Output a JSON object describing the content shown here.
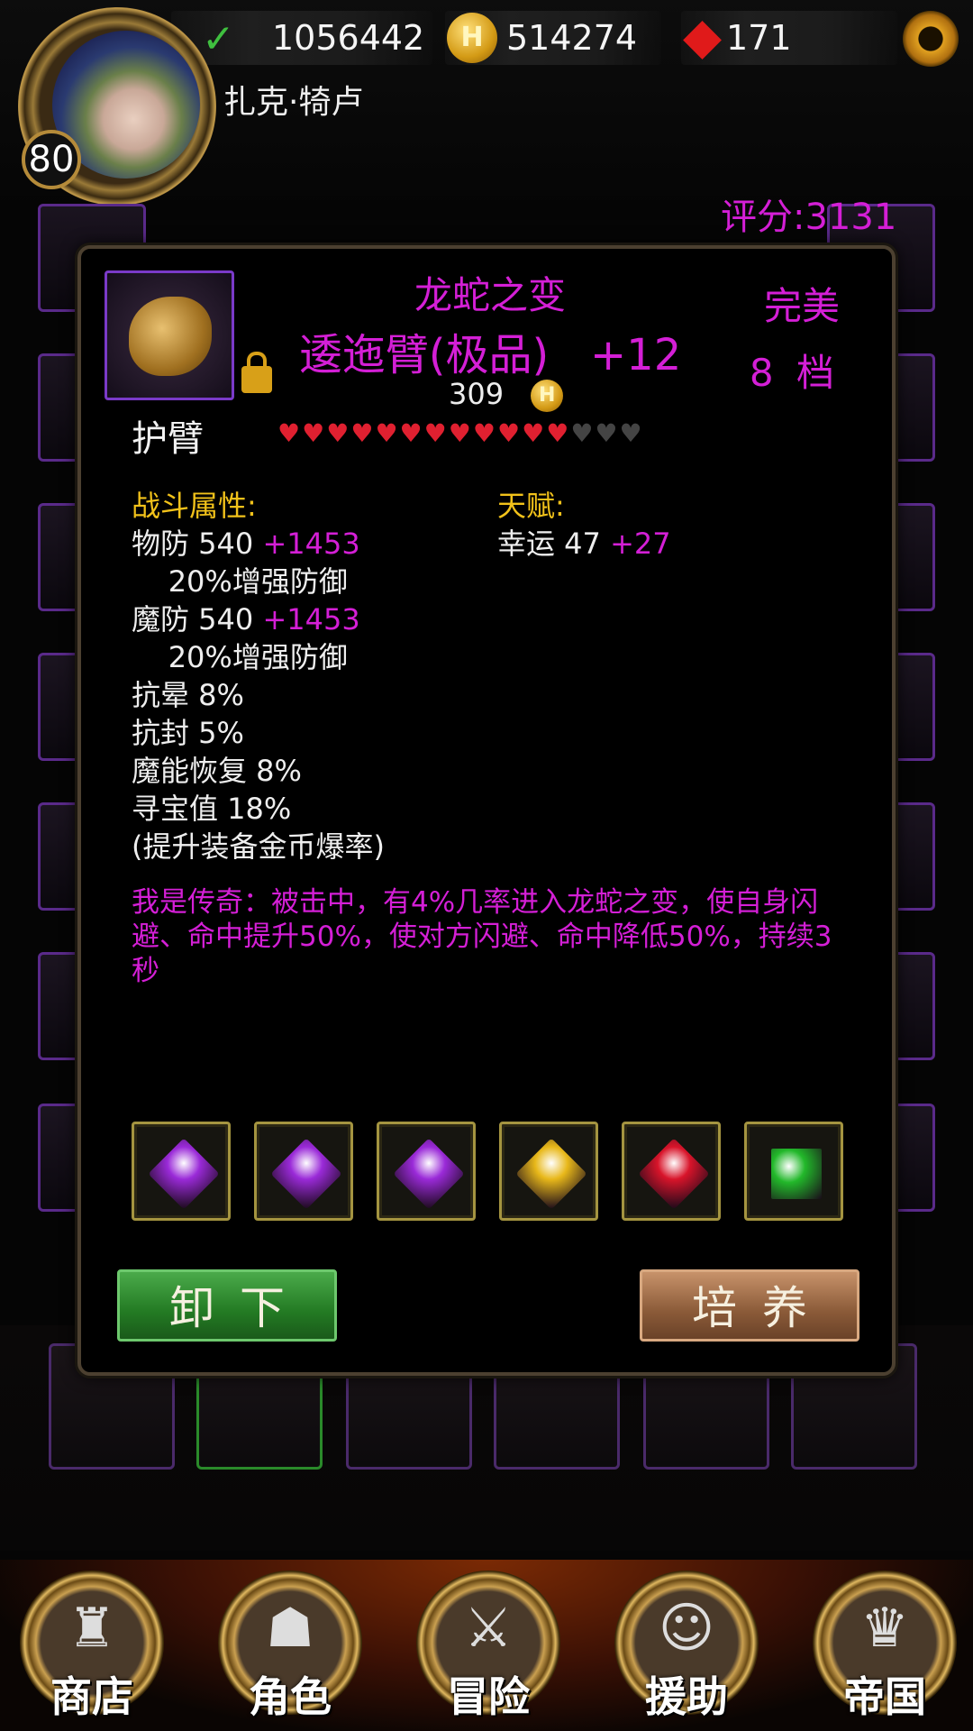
{
  "player": {
    "level": "80",
    "name": "扎克·犄卢",
    "power": "1056442",
    "gold": "514274",
    "gems": "171"
  },
  "score_label": "评分:3131",
  "item": {
    "set_name": "龙蛇之变",
    "full_name": "逶迤臂(极品)   +12",
    "quality": "完美",
    "grade": "8 档",
    "price": "309",
    "slot_name": "护臂",
    "hearts_total": 15,
    "hearts_filled": 12,
    "combat_header": "战斗属性:",
    "talent_header": "天赋:",
    "stats": [
      {
        "base": "物防 540 ",
        "bonus": "+1453"
      },
      {
        "base": "    20%增强防御",
        "bonus": ""
      },
      {
        "base": "魔防 540 ",
        "bonus": "+1453"
      },
      {
        "base": "    20%增强防御",
        "bonus": ""
      },
      {
        "base": "抗晕 8%",
        "bonus": ""
      },
      {
        "base": "抗封 5%",
        "bonus": ""
      },
      {
        "base": "魔能恢复 8%",
        "bonus": ""
      },
      {
        "base": "寻宝值 18%",
        "bonus": ""
      },
      {
        "base": "(提升装备金币爆率)",
        "bonus": ""
      }
    ],
    "talent": {
      "base": "幸运 47 ",
      "bonus": "+27"
    },
    "description": "我是传奇：被击中，有4%几率进入龙蛇之变，使自身闪避、命中提升50%，使对方闪避、命中降低50%，持续3秒",
    "gems": [
      {
        "color": "#9a2ad8",
        "name": "purple-gem-icon"
      },
      {
        "color": "#9a2ad8",
        "name": "purple-gem-icon"
      },
      {
        "color": "#9a2ad8",
        "name": "purple-gem-icon"
      },
      {
        "color": "#e8b81a",
        "name": "yellow-gem-icon"
      },
      {
        "color": "#d8142a",
        "name": "red-gem-icon"
      },
      {
        "color": "#22b82a",
        "name": "green-gem-icon"
      }
    ],
    "unequip_label": "卸下",
    "cultivate_label": "培养"
  },
  "nav": [
    {
      "label": "商店",
      "icon": "castle-icon",
      "glyph": "♜"
    },
    {
      "label": "角色",
      "icon": "hood-icon",
      "glyph": "☗"
    },
    {
      "label": "冒险",
      "icon": "dungeon-gate-icon",
      "glyph": "⚔"
    },
    {
      "label": "援助",
      "icon": "helper-girl-icon",
      "glyph": "☺"
    },
    {
      "label": "帝国",
      "icon": "crown-icon",
      "glyph": "♛"
    }
  ]
}
